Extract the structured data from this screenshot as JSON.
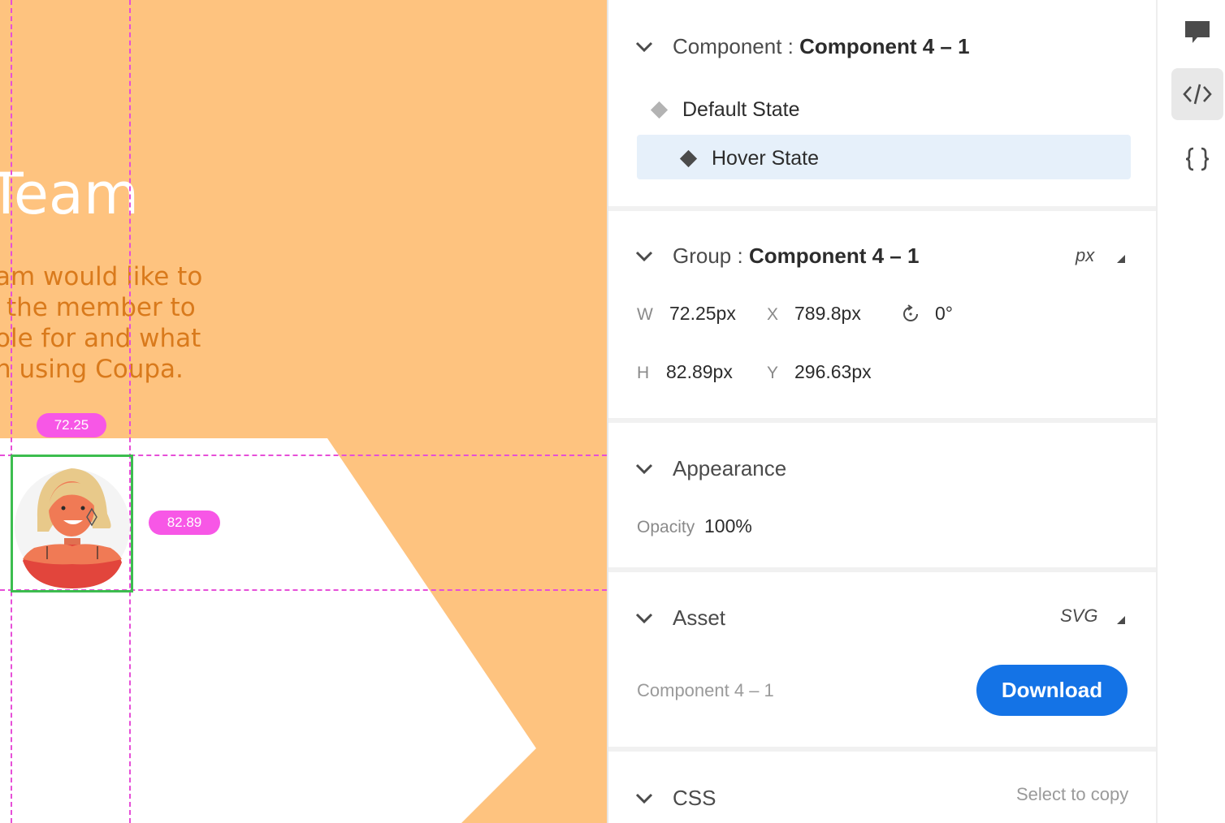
{
  "canvas": {
    "title": "Team",
    "body_lines": [
      "am would like to",
      "the member to",
      "ole for and what",
      "n using Coupa."
    ],
    "width_badge": "72.25",
    "height_badge": "82.89"
  },
  "inspector": {
    "component": {
      "prefix": "Component : ",
      "name": "Component 4 – 1",
      "states": [
        {
          "label": "Default State",
          "selected": false
        },
        {
          "label": "Hover State",
          "selected": true
        }
      ]
    },
    "group": {
      "prefix": "Group : ",
      "name": "Component 4 – 1",
      "unit": "px",
      "w_label": "W",
      "w_value": "72.25px",
      "x_label": "X",
      "x_value": "789.8px",
      "rotation": "0°",
      "h_label": "H",
      "h_value": "82.89px",
      "y_label": "Y",
      "y_value": "296.63px"
    },
    "appearance": {
      "title": "Appearance",
      "opacity_label": "Opacity",
      "opacity_value": "100%"
    },
    "asset": {
      "title": "Asset",
      "format": "SVG",
      "name": "Component 4 – 1",
      "download_label": "Download"
    },
    "css": {
      "title": "CSS",
      "hint": "Select to copy"
    }
  },
  "rail": {
    "icons": [
      "comment-icon",
      "code-icon",
      "braces-icon"
    ],
    "active": "code-icon"
  },
  "colors": {
    "canvas_bg": "#fec37f",
    "guide": "#e64fd8",
    "selection": "#3cbd4f",
    "accent": "#1473e6",
    "selected_row": "#e6f0fa"
  }
}
